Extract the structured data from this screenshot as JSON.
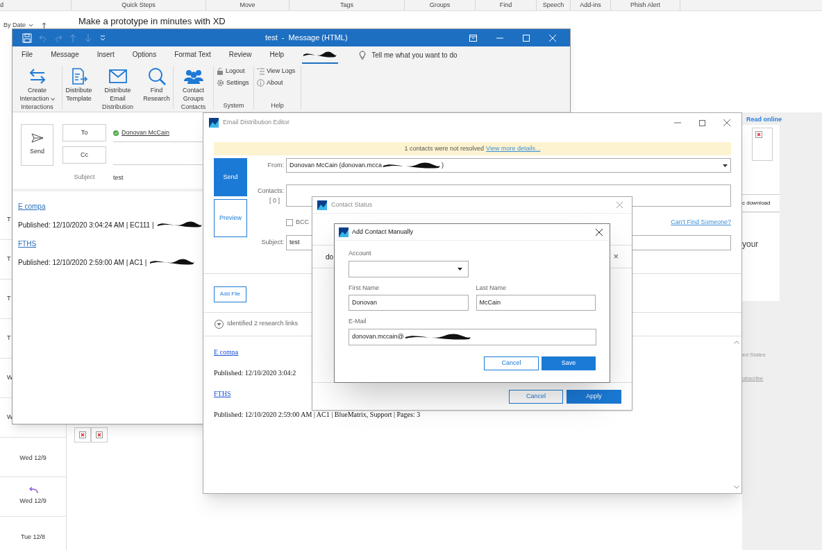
{
  "outlook": {
    "ribbon_groups": [
      "d",
      "Quick Steps",
      "Move",
      "Tags",
      "Groups",
      "Find",
      "Speech",
      "Add-ins",
      "Phish Alert"
    ],
    "sort": "By Date",
    "ad_title": "Make a prototype in minutes with XD",
    "message_list": [
      {
        "kind": "letter",
        "text": "T"
      },
      {
        "kind": "letter",
        "text": "T"
      },
      {
        "kind": "letter",
        "text": "T"
      },
      {
        "kind": "letter",
        "text": "T"
      },
      {
        "kind": "letter",
        "text": "W"
      },
      {
        "kind": "letter",
        "text": "W"
      },
      {
        "kind": "date",
        "text": "Wed 12/9",
        "replied": false
      },
      {
        "kind": "date",
        "text": "Wed 12/9",
        "replied": true
      },
      {
        "kind": "date",
        "text": "Tue 12/8",
        "replied": false
      }
    ],
    "reading_pane": {
      "link": "Read online",
      "download": "c download",
      "body": "your",
      "footer": "ed States",
      "unsubscribe": "ubscribe"
    }
  },
  "message_window": {
    "title": "test  -  Message (HTML)",
    "tabs": [
      {
        "kind": "text",
        "label": "File",
        "selected": false
      },
      {
        "kind": "text",
        "label": "Message",
        "selected": false
      },
      {
        "kind": "text",
        "label": "Insert",
        "selected": false
      },
      {
        "kind": "text",
        "label": "Options",
        "selected": false
      },
      {
        "kind": "text",
        "label": "Format Text",
        "selected": false
      },
      {
        "kind": "text",
        "label": "Review",
        "selected": false
      },
      {
        "kind": "text",
        "label": "Help",
        "selected": false
      },
      {
        "kind": "redacted",
        "selected": true
      }
    ],
    "tell_me": "Tell me what you want to do",
    "ribbon": [
      {
        "group": "Interactions",
        "items": [
          {
            "kind": "large",
            "label": "Create Interaction",
            "dropdown": true
          }
        ]
      },
      {
        "group": "Distribution",
        "items": [
          {
            "kind": "large",
            "label": "Distribute Template",
            "dropdown": false
          },
          {
            "kind": "large",
            "label": "Distribute Email",
            "dropdown": false
          },
          {
            "kind": "large",
            "label": "Find Research",
            "dropdown": false
          }
        ]
      },
      {
        "group": "Contacts",
        "items": [
          {
            "kind": "large",
            "label": "Contact Groups",
            "dropdown": false
          }
        ]
      },
      {
        "group": "System",
        "items": [
          {
            "kind": "small",
            "label": "Logout"
          },
          {
            "kind": "small",
            "label": "Settings"
          }
        ]
      },
      {
        "group": "Help",
        "items": [
          {
            "kind": "small",
            "label": "View Logs"
          },
          {
            "kind": "small",
            "label": "About"
          }
        ]
      }
    ],
    "send": "Send",
    "to": "To",
    "cc": "Cc",
    "recipient": "Donovan McCain",
    "subject_label": "Subject",
    "subject": "test",
    "body": [
      {
        "kind": "link",
        "text": "E compa"
      },
      {
        "kind": "line",
        "text": "Published: 12/10/2020 3:04:24 AM | EC111 |",
        "redacted": true
      },
      {
        "kind": "link",
        "text": "FTHS"
      },
      {
        "kind": "line",
        "text": "Published: 12/10/2020 2:59:00 AM | AC1 |",
        "redacted": true
      }
    ]
  },
  "editor": {
    "title": "Email Distribution Editor",
    "banner": "1 contacts were not resolved",
    "banner_link": "View more details...",
    "send": "Send",
    "preview": "Preview",
    "from_label": "From:",
    "from": "Donovan McCain (donovan.mcca",
    "from_end": ")",
    "contacts_label": "Contacts:",
    "contacts_count": "[ 0 ]",
    "bcc": {
      "label": "BCC",
      "checked": false
    },
    "cant_find": "Can't Find Someone?",
    "subject_label": "Subject:",
    "subject": "test",
    "add_file": "Add File",
    "research": "Identified 2 research links",
    "body": [
      {
        "kind": "link",
        "text": "E compa"
      },
      {
        "kind": "line",
        "text": "Published: 12/10/2020 3:04:2"
      },
      {
        "kind": "link",
        "text": "FTHS"
      },
      {
        "kind": "line",
        "text": "Published: 12/10/2020 2:59:00 AM | AC1 | BlueMatrix, Support | Pages: 3"
      }
    ]
  },
  "contact_status": {
    "title": "Contact Status",
    "row_text": "do",
    "remove": "×",
    "cancel": "Cancel",
    "apply": "Apply"
  },
  "add_contact": {
    "title": "Add Contact Manually",
    "account_label": "Account",
    "first_label": "First Name",
    "first": "Donovan",
    "last_label": "Last Name",
    "last": "McCain",
    "email_label": "E-Mail",
    "email": "donovan.mccain@",
    "cancel": "Cancel",
    "save": "Save"
  }
}
